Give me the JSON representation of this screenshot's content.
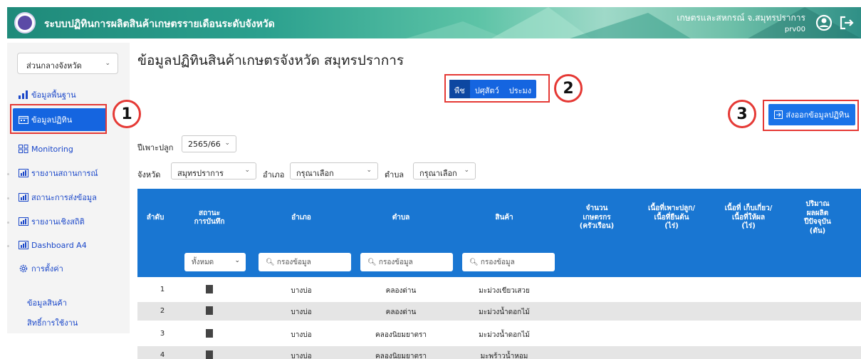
{
  "header": {
    "app_title": "ระบบปฏิทินการผลิตสินค้าเกษตรรายเดือนระดับจังหวัด",
    "user_org": "เกษตรและสหกรณ์ จ.สมุทรปราการ",
    "user_id": "prv00",
    "icons": [
      "user-circle-icon",
      "logout-icon"
    ]
  },
  "sidebar": {
    "province_select": "ส่วนกลางจังหวัด",
    "items": [
      {
        "label": "ข้อมูลพื้นฐาน",
        "icon": "bar-chart-icon"
      },
      {
        "label": "ข้อมูลปฏิทิน",
        "icon": "calendar-icon",
        "active": true
      },
      {
        "label": "Monitoring",
        "icon": "grid-icon"
      },
      {
        "label": "รายงานสถานการณ์",
        "icon": "report-icon"
      },
      {
        "label": "สถานะการส่งข้อมูล",
        "icon": "report-icon"
      },
      {
        "label": "รายงานเชิงสถิติ",
        "icon": "report-icon"
      },
      {
        "label": "Dashboard A4",
        "icon": "report-icon"
      },
      {
        "label": "การตั้งค่า",
        "icon": "gear-icon"
      }
    ],
    "sub_items": [
      "ข้อมูลสินค้า",
      "สิทธิ์การใช้งาน"
    ]
  },
  "main": {
    "title": "ข้อมูลปฏิทินสินค้าเกษตรจังหวัด สมุทรปราการ",
    "tabs": [
      "พืช",
      "ปศุสัตว์",
      "ประมง"
    ],
    "export_label": "ส่งออกข้อมูลปฏิทิน",
    "season_label": "ปีเพาะปลูก",
    "season_value": "2565/66",
    "province_label": "จังหวัด",
    "province_value": "สมุทรปราการ",
    "district_label": "อำเภอ",
    "district_value": "กรุณาเลือก",
    "subdistrict_label": "ตำบล",
    "subdistrict_value": "กรุณาเลือก"
  },
  "annotations": [
    "1",
    "2",
    "3"
  ],
  "table": {
    "headers": {
      "no": "ลำดับ",
      "status": "สถานะ\nการบันทึก",
      "district": "อำเภอ",
      "subdistrict": "ตำบล",
      "product": "สินค้า",
      "farmers": "จำนวน\nเกษตรกร\n(ครัวเรือน)",
      "planted_area": "เนื้อที่เพาะปลูก/\nเนื้อที่ยืนต้น\n(ไร่)",
      "harvest_area": "เนื้อที่ เก็บเกี่ยว/\nเนื้อที่ให้ผล\n(ไร่)",
      "yield": "ปริมาณ\nผลผลิต\nปีปัจจุบัน\n(ตัน)"
    },
    "filter": {
      "status_all": "ทั้งหมด",
      "placeholder": "กรองข้อมูล"
    },
    "rows": [
      {
        "no": "1",
        "district": "บางบ่อ",
        "subdistrict": "คลองด่าน",
        "product": "มะม่วงเขียวเสวย"
      },
      {
        "no": "2",
        "district": "บางบ่อ",
        "subdistrict": "คลองด่าน",
        "product": "มะม่วงน้ำดอกไม้"
      },
      {
        "no": "3",
        "district": "บางบ่อ",
        "subdistrict": "คลองนิยมยาตรา",
        "product": "มะม่วงน้ำดอกไม้"
      },
      {
        "no": "4",
        "district": "บางบ่อ",
        "subdistrict": "คลองนิยมยาตรา",
        "product": "มะพร้าวน้ำหอม"
      }
    ]
  }
}
